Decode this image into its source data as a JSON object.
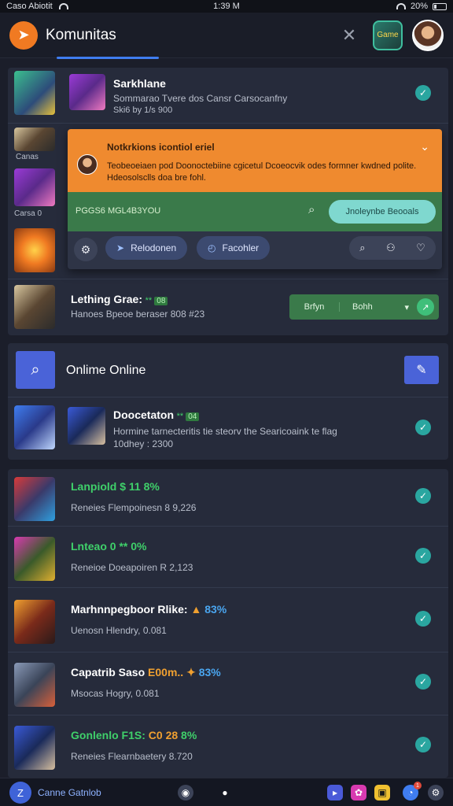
{
  "status": {
    "carrier": "Caso Abiotit",
    "time": "1:39 M",
    "battery": "20%"
  },
  "app": {
    "title": "Komunitas",
    "game_badge": "Game"
  },
  "top_rows": [
    {
      "title": "Sarkhlane",
      "sub": "Sommarao Tvere dos Cansr Carsocanfny",
      "meta": "Ski6 by 1/s 900"
    }
  ],
  "left_labels": {
    "lbl1": "Canas",
    "lbl2": "Carsa 0"
  },
  "popup": {
    "title": "Notkrkions icontiol eriel",
    "body": "Teobeoeiaen pod Doonoctebiine cgicetul Dcoeocvik odes formner kwdned polite. Hdeosolsclls doa bre fohl.",
    "green_label": "PGGS6 MGL4B3YOU",
    "action": "Jnoleynbe Beooals",
    "pill1": "Relodonen",
    "pill2": "Facohler"
  },
  "platform_row": {
    "title": "Lething Grae:",
    "stars": "** ",
    "score": "08",
    "sub": "Hanoes Bpeoe beraser 808 #23",
    "filter_left": "Brfyn ",
    "filter_right": "Bohh",
    "filter_dd": "▾"
  },
  "online": {
    "title": "Onlime Online"
  },
  "doc_row": {
    "title": "Doocetaton",
    "stars": "** ",
    "score": "04",
    "sub": "Hormine tarnecteritis tie steorv the Searicoaink te flag",
    "meta": "10dhey : 2300"
  },
  "list": [
    {
      "title": "Lanpiold ",
      "tag": "$ 11",
      "score": "8%",
      "sub": "Reneies Flempoinesn 8 9,226",
      "style": "green"
    },
    {
      "title": "Lnteao ",
      "tag": "0 ** ",
      "score": "0%",
      "sub": "Reneioe Doeapoiren R 2,123",
      "style": "green"
    },
    {
      "title": "Marhnnpegboor Rlike:",
      "tag": "",
      "score": "83%",
      "sub": "Uenosn Hlendry, 0.081",
      "style": "white-blue"
    },
    {
      "title": "Capatrib Saso ",
      "tag": "E00m..",
      "score": "83%",
      "sub": "Msocas Hogry, 0.081",
      "style": "white-orange"
    },
    {
      "title": "Gonlenlo F1S: ",
      "tag": "C0 28",
      "score": "8%",
      "sub": "Reneies Flearnbaetery 8.720",
      "style": "green"
    }
  ],
  "bottom": {
    "label": "Canne Gatnlob",
    "notif_count": "1"
  },
  "colors": {
    "accent": "#3f7df0",
    "orange": "#ef8a2f",
    "green": "#3a7a4a",
    "card": "#262b3b",
    "bg": "#1b1e2a"
  },
  "icons": [
    "logo-icon",
    "close-icon",
    "check-icon",
    "search-icon",
    "gear-icon",
    "heart-icon",
    "chevron-down-icon"
  ]
}
